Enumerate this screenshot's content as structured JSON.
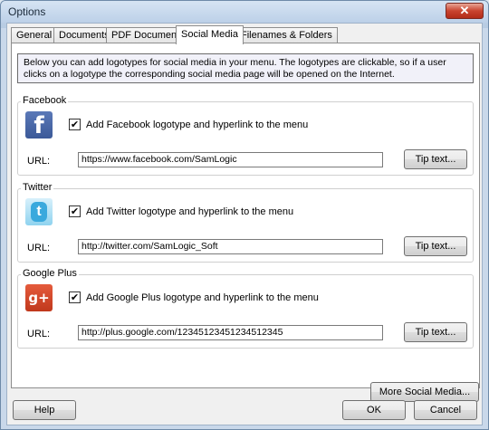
{
  "window": {
    "title": "Options",
    "close_glyph": "✕"
  },
  "tabs": [
    {
      "label": "General"
    },
    {
      "label": "Documents"
    },
    {
      "label": "PDF Documents"
    },
    {
      "label": "Social Media",
      "active": true
    },
    {
      "label": "Filenames & Folders"
    }
  ],
  "info_text": "Below you can add logotypes for social media in your menu. The logotypes are clickable, so if a user clicks on a logotype the corresponding social media page will be opened on the Internet.",
  "groups": {
    "facebook": {
      "title": "Facebook",
      "logo_glyph": "f",
      "icon": "facebook-icon",
      "checked": true,
      "check_glyph": "✔",
      "checkbox_label": "Add Facebook logotype and hyperlink to the menu",
      "url_label": "URL:",
      "url_value": "https://www.facebook.com/SamLogic",
      "tip_button": "Tip text..."
    },
    "twitter": {
      "title": "Twitter",
      "logo_glyph": "t",
      "icon": "twitter-icon",
      "checked": true,
      "check_glyph": "✔",
      "checkbox_label": "Add Twitter logotype and hyperlink to the menu",
      "url_label": "URL:",
      "url_value": "http://twitter.com/SamLogic_Soft",
      "tip_button": "Tip text..."
    },
    "googleplus": {
      "title": "Google Plus",
      "logo_glyph": "g+",
      "icon": "google-plus-icon",
      "checked": true,
      "check_glyph": "✔",
      "checkbox_label": "Add Google Plus logotype and hyperlink to the menu",
      "url_label": "URL:",
      "url_value": "http://plus.google.com/12345123451234512345",
      "tip_button": "Tip text..."
    }
  },
  "buttons": {
    "more_social_media": "More Social Media...",
    "help": "Help",
    "ok": "OK",
    "cancel": "Cancel"
  }
}
